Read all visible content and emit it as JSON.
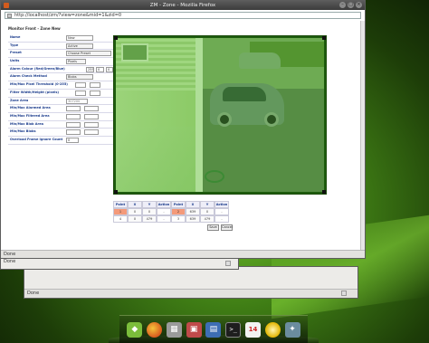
{
  "browser": {
    "title": "ZM - Zone - Mozilla Firefox",
    "url": "http://localhost/zm/?view=zone&mid=1&zid=0",
    "status": "Done"
  },
  "back_windows": [
    {
      "status": "Done"
    },
    {
      "status": "Done"
    }
  ],
  "page": {
    "title": "Monitor Front - Zone New"
  },
  "form": {
    "rows": [
      {
        "label": "Name",
        "value": "New"
      },
      {
        "label": "Type",
        "value": "Active"
      },
      {
        "label": "Preset",
        "value": "Choose Preset"
      },
      {
        "label": "Units",
        "value": "Pixels"
      },
      {
        "label": "Alarm Colour (Red/Green/Blue)",
        "values": [
          "255",
          "0",
          "0"
        ]
      },
      {
        "label": "Alarm Check Method",
        "value": "Blobs"
      },
      {
        "label": "Min/Max Pixel Threshold (0-255)",
        "values": [
          "",
          ""
        ]
      },
      {
        "label": "Filter Width/Height (pixels)",
        "values": [
          "",
          ""
        ]
      },
      {
        "label": "Zone Area",
        "values": [
          "307200"
        ]
      },
      {
        "label": "Min/Max Alarmed Area",
        "values": [
          "",
          ""
        ]
      },
      {
        "label": "Min/Max Filtered Area",
        "values": [
          "",
          ""
        ]
      },
      {
        "label": "Min/Max Blob Area",
        "values": [
          "",
          ""
        ]
      },
      {
        "label": "Min/Max Blobs",
        "values": [
          "",
          ""
        ]
      },
      {
        "label": "Overload Frame Ignore Count",
        "values": [
          "0"
        ]
      }
    ]
  },
  "points": {
    "headers": [
      "Point",
      "X",
      "Y",
      "Action",
      "Point",
      "X",
      "Y",
      "Action"
    ],
    "rows": [
      [
        "1",
        "0",
        "0",
        "-",
        "2",
        "639",
        "0",
        "-"
      ],
      [
        "4",
        "0",
        "479",
        "-",
        "3",
        "639",
        "479",
        "-"
      ]
    ]
  },
  "buttons": {
    "save": "Save",
    "cancel": "Cancel"
  },
  "dock": {
    "icons": [
      "mint-menu-icon",
      "firefox-icon",
      "files-icon",
      "image-viewer-icon",
      "save-icon",
      "terminal-icon",
      "calendar-icon",
      "bulb-icon",
      "tools-icon"
    ],
    "terminal_glyph": ">_",
    "calendar_day": "14"
  }
}
